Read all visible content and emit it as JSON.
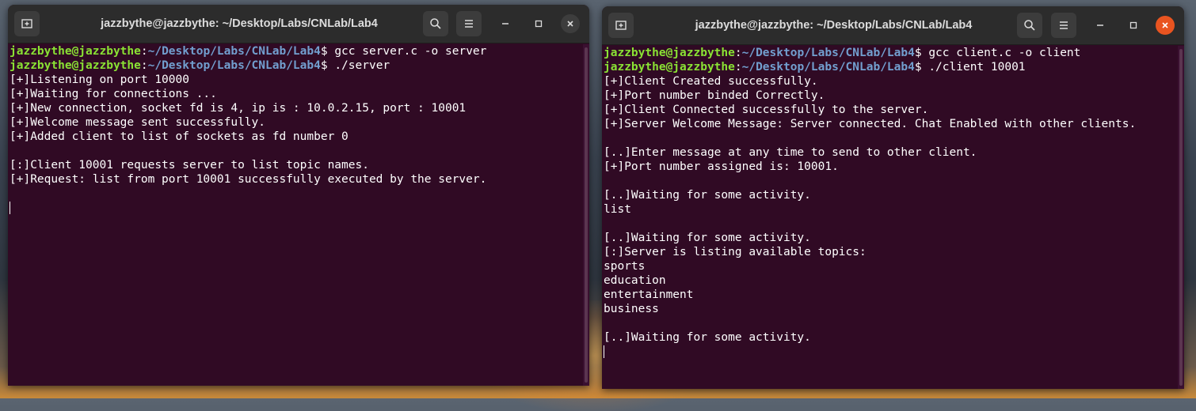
{
  "windows": [
    {
      "title": "jazzbythe@jazzbythe: ~/Desktop/Labs/CNLab/Lab4",
      "prompt_user": "jazzbythe@jazzbythe",
      "prompt_path": "~/Desktop/Labs/CNLab/Lab4",
      "prompt_symbol": "$",
      "lines": [
        {
          "type": "cmd",
          "text": " gcc server.c -o server"
        },
        {
          "type": "cmd",
          "text": " ./server"
        },
        {
          "type": "out",
          "text": "[+]Listening on port 10000"
        },
        {
          "type": "out",
          "text": "[+]Waiting for connections ..."
        },
        {
          "type": "out",
          "text": "[+]New connection, socket fd is 4, ip is : 10.0.2.15, port : 10001"
        },
        {
          "type": "out",
          "text": "[+]Welcome message sent successfully."
        },
        {
          "type": "out",
          "text": "[+]Added client to list of sockets as fd number 0"
        },
        {
          "type": "out",
          "text": ""
        },
        {
          "type": "out",
          "text": "[:]Client 10001 requests server to list topic names."
        },
        {
          "type": "out",
          "text": "[+]Request: list from port 10001 successfully executed by the server."
        },
        {
          "type": "out",
          "text": ""
        },
        {
          "type": "cursor",
          "text": ""
        }
      ]
    },
    {
      "title": "jazzbythe@jazzbythe: ~/Desktop/Labs/CNLab/Lab4",
      "prompt_user": "jazzbythe@jazzbythe",
      "prompt_path": "~/Desktop/Labs/CNLab/Lab4",
      "prompt_symbol": "$",
      "lines": [
        {
          "type": "cmd",
          "text": " gcc client.c -o client"
        },
        {
          "type": "cmd",
          "text": " ./client 10001"
        },
        {
          "type": "out",
          "text": "[+]Client Created successfully."
        },
        {
          "type": "out",
          "text": "[+]Port number binded Correctly."
        },
        {
          "type": "out",
          "text": "[+]Client Connected successfully to the server."
        },
        {
          "type": "out",
          "text": "[+]Server Welcome Message: Server connected. Chat Enabled with other clients."
        },
        {
          "type": "out",
          "text": ""
        },
        {
          "type": "out",
          "text": "[..]Enter message at any time to send to other client."
        },
        {
          "type": "out",
          "text": "[+]Port number assigned is: 10001."
        },
        {
          "type": "out",
          "text": ""
        },
        {
          "type": "out",
          "text": "[..]Waiting for some activity."
        },
        {
          "type": "out",
          "text": "list"
        },
        {
          "type": "out",
          "text": ""
        },
        {
          "type": "out",
          "text": "[..]Waiting for some activity."
        },
        {
          "type": "out",
          "text": "[:]Server is listing available topics:"
        },
        {
          "type": "out",
          "text": "sports"
        },
        {
          "type": "out",
          "text": "education"
        },
        {
          "type": "out",
          "text": "entertainment"
        },
        {
          "type": "out",
          "text": "business"
        },
        {
          "type": "out",
          "text": ""
        },
        {
          "type": "out",
          "text": "[..]Waiting for some activity."
        },
        {
          "type": "cursor",
          "text": ""
        }
      ]
    }
  ],
  "icons": {
    "new_tab": "new-tab-icon",
    "search": "search-icon",
    "menu": "hamburger-menu-icon",
    "minimize": "minimize-icon",
    "maximize": "maximize-icon",
    "close": "close-icon"
  },
  "colors": {
    "terminal_bg": "#300a24",
    "user_green": "#8ae234",
    "path_blue": "#729fcf",
    "close_red": "#e95420"
  }
}
